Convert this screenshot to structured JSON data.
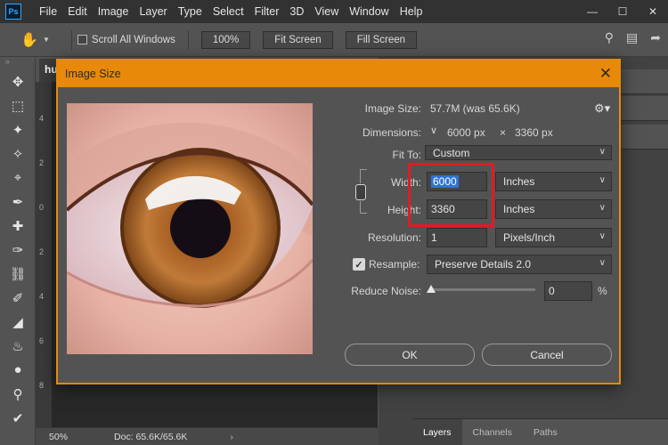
{
  "app": {
    "logo": "Ps",
    "menu": [
      "File",
      "Edit",
      "Image",
      "Layer",
      "Type",
      "Select",
      "Filter",
      "3D",
      "View",
      "Window",
      "Help"
    ],
    "window_controls": [
      "minimize-icon",
      "maximize-icon",
      "close-icon"
    ]
  },
  "options_bar": {
    "scroll_all_label": "Scroll All Windows",
    "zoom_btn": "100%",
    "fit_screen_btn": "Fit Screen",
    "fill_screen_btn": "Fill Screen"
  },
  "document": {
    "tab_label": "hu",
    "ruler_marks": [
      "4",
      "2",
      "0",
      "2",
      "4",
      "6",
      "8"
    ],
    "zoom": "50%",
    "doc_info": "Doc: 65.6K/65.6K"
  },
  "panels": {
    "tabs": [
      "Layers",
      "Channels",
      "Paths"
    ]
  },
  "dialog": {
    "title": "Image Size",
    "image_size_label": "Image Size:",
    "image_size_value": "57.7M (was 65.6K)",
    "dimensions_label": "Dimensions:",
    "dim_width": "6000 px",
    "dim_x": "×",
    "dim_height": "3360 px",
    "fit_to_label": "Fit To:",
    "fit_to_value": "Custom",
    "width_label": "Width:",
    "width_value": "6000",
    "width_unit": "Inches",
    "height_label": "Height:",
    "height_value": "3360",
    "height_unit": "Inches",
    "resolution_label": "Resolution:",
    "resolution_value": "1",
    "resolution_unit": "Pixels/Inch",
    "resample_label": "Resample:",
    "resample_checked": true,
    "resample_value": "Preserve Details 2.0",
    "reduce_noise_label": "Reduce Noise:",
    "reduce_noise_value": "0",
    "reduce_noise_unit": "%",
    "reduce_noise_level": 0,
    "ok_label": "OK",
    "cancel_label": "Cancel"
  },
  "colors": {
    "accent": "#e8890a",
    "highlight": "#e21b23",
    "selection": "#2f74d6"
  }
}
